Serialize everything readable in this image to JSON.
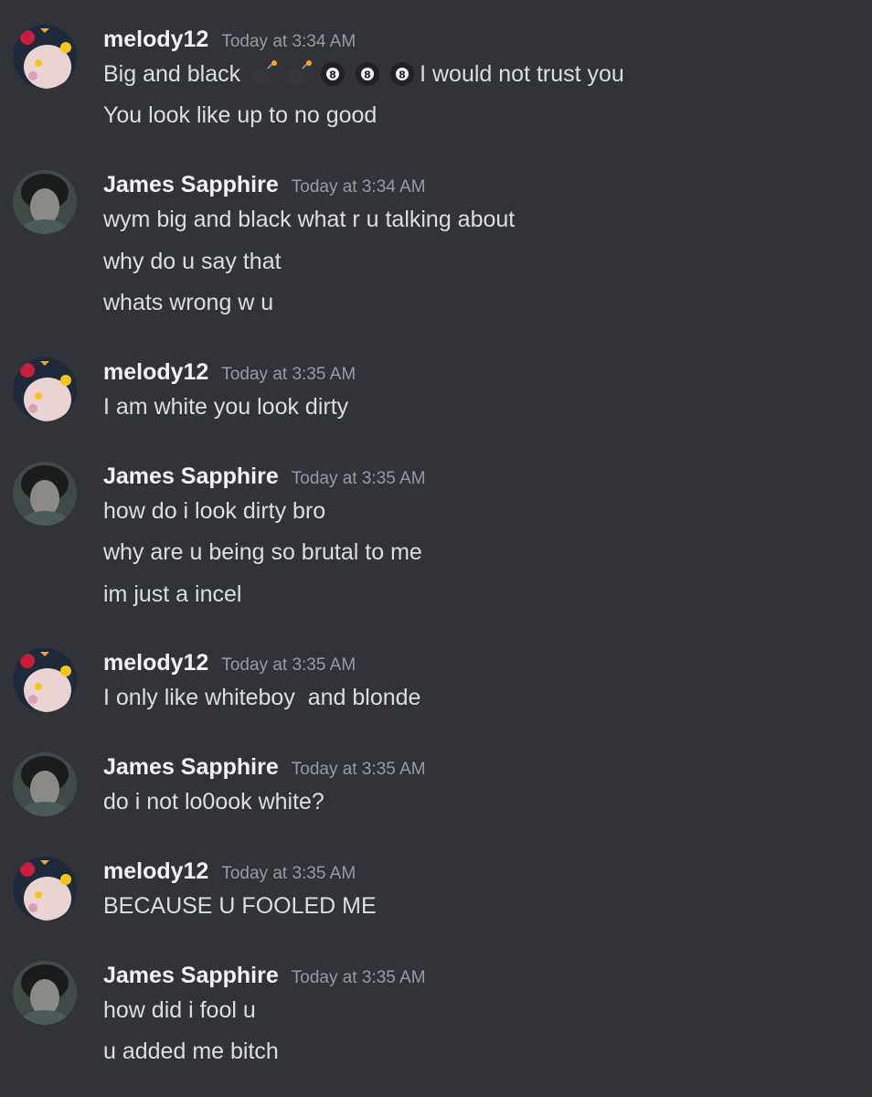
{
  "messages": [
    {
      "author": "melody12",
      "avatar": "melody-avatar",
      "time": "Today at 3:34 AM",
      "lines": [
        {
          "parts": [
            "Big and black",
            "",
            "",
            "",
            "",
            "",
            "I would not trust you"
          ],
          "emojis": [
            "bomb-emoji",
            "bomb-emoji",
            "8ball-emoji",
            "8ball-emoji",
            "8ball-emoji"
          ]
        },
        {
          "text": "You look like up to no good"
        }
      ]
    },
    {
      "author": "James Sapphire",
      "avatar": "james-avatar",
      "time": "Today at 3:34 AM",
      "lines": [
        {
          "text": "wym big and black what r u talking about"
        },
        {
          "text": "why do u say that"
        },
        {
          "text": "whats wrong w u"
        }
      ]
    },
    {
      "author": "melody12",
      "avatar": "melody-avatar",
      "time": "Today at 3:35 AM",
      "lines": [
        {
          "text": "I am white you look dirty"
        }
      ]
    },
    {
      "author": "James Sapphire",
      "avatar": "james-avatar",
      "time": "Today at 3:35 AM",
      "lines": [
        {
          "text": "how do i look dirty bro"
        },
        {
          "text": "why are u being so brutal to me"
        },
        {
          "text": "im just a incel"
        }
      ]
    },
    {
      "author": "melody12",
      "avatar": "melody-avatar",
      "time": "Today at 3:35 AM",
      "lines": [
        {
          "text": "I only like whiteboy  and blonde"
        }
      ]
    },
    {
      "author": "James Sapphire",
      "avatar": "james-avatar",
      "time": "Today at 3:35 AM",
      "lines": [
        {
          "text": "do i not lo0ook white?"
        }
      ]
    },
    {
      "author": "melody12",
      "avatar": "melody-avatar",
      "time": "Today at 3:35 AM",
      "lines": [
        {
          "text": "BECAUSE U FOOLED ME"
        }
      ]
    },
    {
      "author": "James Sapphire",
      "avatar": "james-avatar",
      "time": "Today at 3:35 AM",
      "lines": [
        {
          "text": "how did i fool u"
        },
        {
          "text": "u added me bitch"
        }
      ]
    }
  ],
  "colors": {
    "background": "#313338",
    "username": "#f2f3f5",
    "timestamp": "#949ba4",
    "text": "#dbdee1"
  }
}
